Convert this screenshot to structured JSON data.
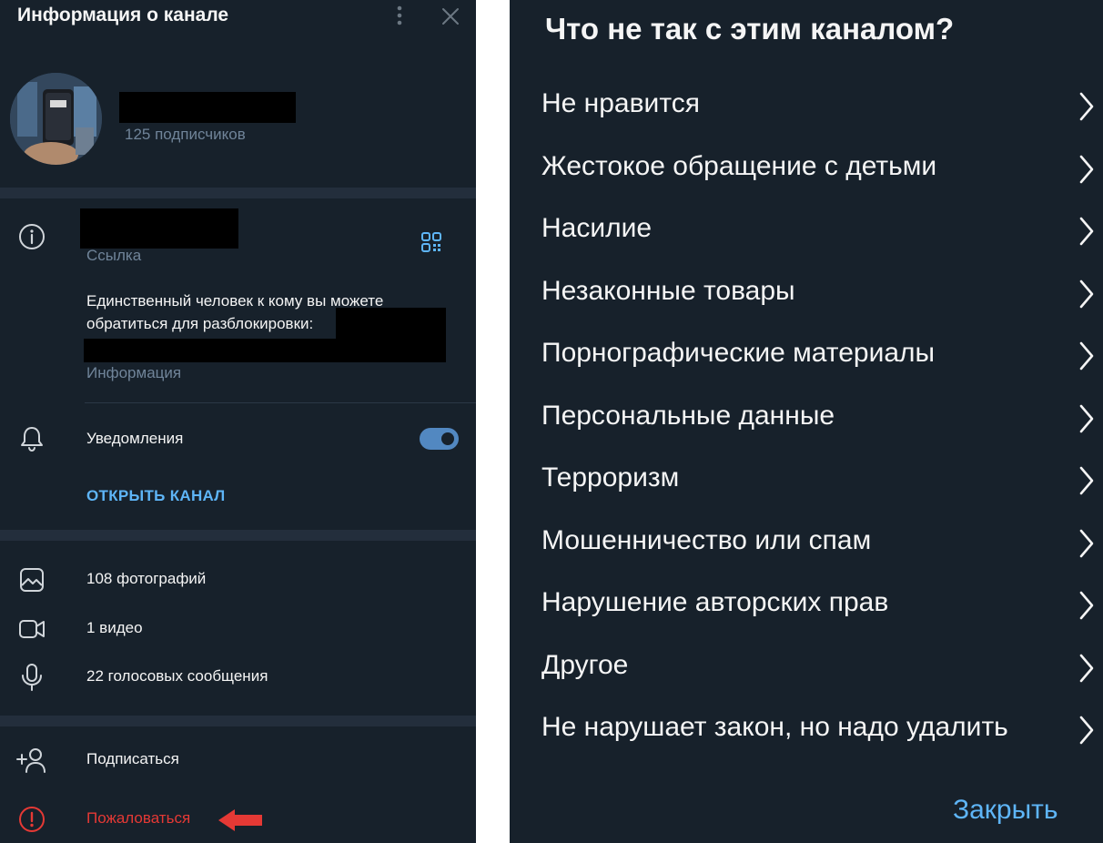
{
  "info_panel": {
    "title": "Информация о канале",
    "subscribers": "125 подписчиков",
    "link_caption": "Ссылка",
    "description": "Единственный человек к кому вы можете\nобратиться для разблокировки:",
    "description_caption": "Информация",
    "notifications_label": "Уведомления",
    "notifications_enabled": true,
    "open_channel": "ОТКРЫТЬ КАНАЛ",
    "media": {
      "photos": "108 фотографий",
      "videos": "1 видео",
      "voice": "22 голосовых сообщения"
    },
    "subscribe": "Подписаться",
    "report": "Пожаловаться"
  },
  "report_dialog": {
    "title": "Что не так с этим каналом?",
    "reasons": [
      "Не нравится",
      "Жестокое обращение с детьми",
      "Насилие",
      "Незаконные товары",
      "Порнографические материалы",
      "Персональные данные",
      "Терроризм",
      "Мошенничество или спам",
      "Нарушение авторских прав",
      "Другое",
      "Не нарушает закон, но надо удалить"
    ],
    "close": "Закрыть"
  },
  "colors": {
    "background": "#17212b",
    "separator": "#232e3c",
    "text": "#f5f5f5",
    "muted": "#708499",
    "accent": "#5eb5f7",
    "danger": "#e53935",
    "arrow": "#e53935"
  },
  "icons": [
    "more-vertical-icon",
    "close-icon",
    "info-icon",
    "qr-code-icon",
    "bell-icon",
    "photo-icon",
    "video-icon",
    "microphone-icon",
    "add-user-icon",
    "report-icon",
    "chevron-right-icon",
    "red-arrow-icon"
  ]
}
